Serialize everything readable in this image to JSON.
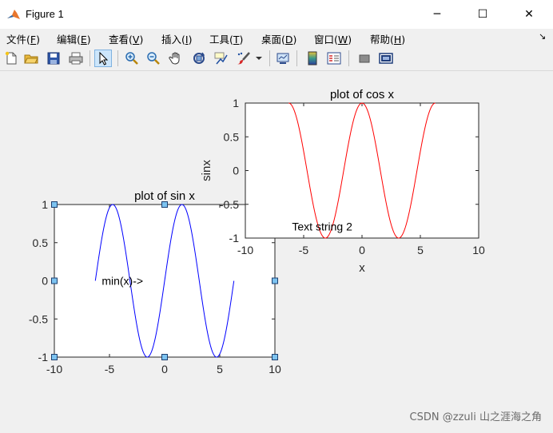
{
  "window": {
    "title": "Figure 1",
    "minimize": "─",
    "maximize": "☐",
    "close": "✕"
  },
  "menu": {
    "items": [
      {
        "label": "文件(",
        "key": "F",
        "end": ")"
      },
      {
        "label": "编辑(",
        "key": "E",
        "end": ")"
      },
      {
        "label": "查看(",
        "key": "V",
        "end": ")"
      },
      {
        "label": "插入(",
        "key": "I",
        "end": ")"
      },
      {
        "label": "工具(",
        "key": "T",
        "end": ")"
      },
      {
        "label": "桌面(",
        "key": "D",
        "end": ")"
      },
      {
        "label": "窗口(",
        "key": "W",
        "end": ")"
      },
      {
        "label": "帮助(",
        "key": "H",
        "end": ")"
      }
    ],
    "dock_arrow": "↘"
  },
  "toolbar": {
    "icons": [
      "new-figure-icon",
      "open-file-icon",
      "save-icon",
      "print-icon",
      "edit-plot-arrow-icon",
      "zoom-in-icon",
      "zoom-out-icon",
      "pan-hand-icon",
      "rotate-3d-icon",
      "data-cursor-icon",
      "brush-icon",
      "brush-dropdown-icon",
      "link-plot-icon",
      "insert-colorbar-icon",
      "insert-legend-icon",
      "hide-plot-tools-icon",
      "show-plot-tools-icon"
    ]
  },
  "chart_data": [
    {
      "type": "line",
      "title": "plot of sin x",
      "xlabel": "",
      "ylabel": "",
      "xlim": [
        -10,
        10
      ],
      "ylim": [
        -1,
        1
      ],
      "xticks": [
        "-10",
        "-5",
        "0",
        "5",
        "10"
      ],
      "yticks": [
        "1",
        "0.5",
        "0",
        "-0.5",
        "-1"
      ],
      "series": [
        {
          "function": "sin",
          "x_range": [
            -6.283,
            6.283
          ],
          "color": "#0000ff"
        }
      ],
      "annotations": [
        {
          "text": "min(x)->",
          "x": -5.7,
          "y": 0
        }
      ],
      "selected": true
    },
    {
      "type": "line",
      "title": "plot of cos x",
      "xlabel": "x",
      "ylabel": "sinx",
      "xlim": [
        -10,
        10
      ],
      "ylim": [
        -1,
        1
      ],
      "xticks": [
        "-10",
        "-5",
        "0",
        "5",
        "10"
      ],
      "yticks": [
        "1",
        "0.5",
        "0",
        "-0.5",
        "-1"
      ],
      "series": [
        {
          "function": "cos",
          "x_range": [
            -6.283,
            6.283
          ],
          "color": "#ff0000"
        }
      ],
      "annotations": [
        {
          "text": "Text string 2",
          "x": -6,
          "y": -0.83
        }
      ]
    }
  ],
  "watermark": "CSDN @zzuli 山之涯海之角"
}
